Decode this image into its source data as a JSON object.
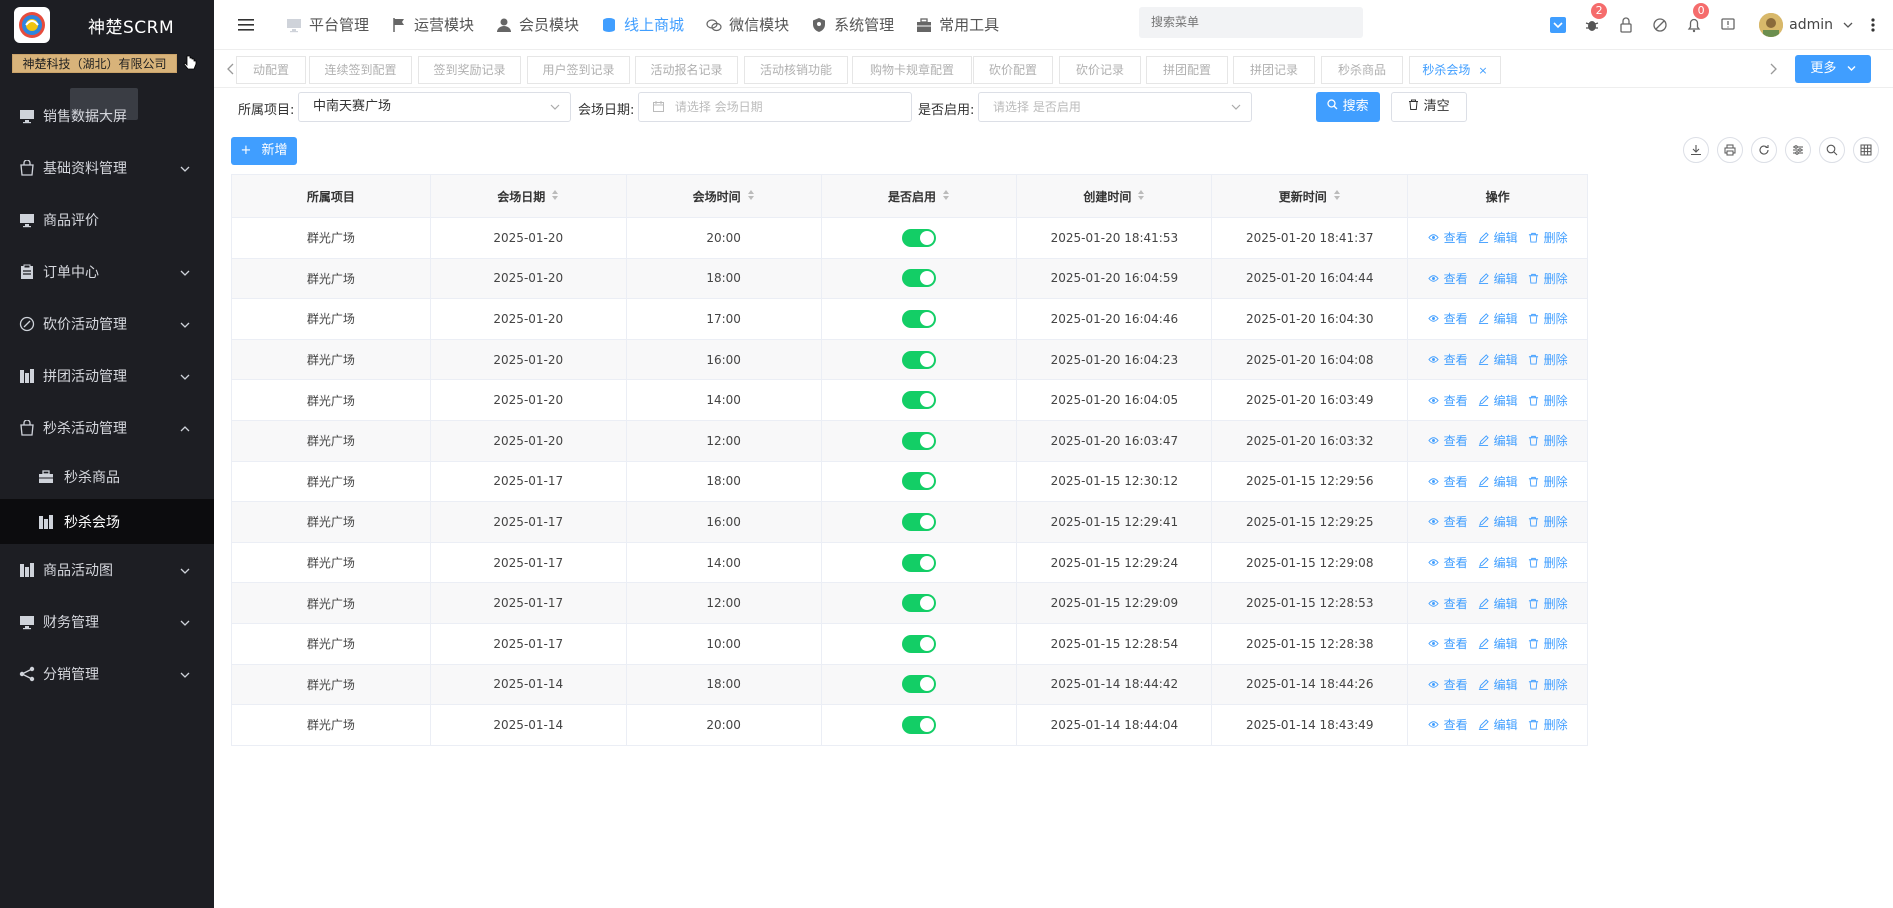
{
  "app": {
    "title": "神楚SCRM",
    "company": "神楚科技（湖北）有限公司"
  },
  "sidebar": {
    "items": [
      {
        "label": "销售数据大屏",
        "icon": "monitor-icon",
        "expandable": false
      },
      {
        "label": "基础资料管理",
        "icon": "bag-icon",
        "expandable": true
      },
      {
        "label": "商品评价",
        "icon": "monitor-icon",
        "expandable": false
      },
      {
        "label": "订单中心",
        "icon": "clipboard-icon",
        "expandable": true
      },
      {
        "label": "砍价活动管理",
        "icon": "discount-icon",
        "expandable": true
      },
      {
        "label": "拼团活动管理",
        "icon": "building-icon",
        "expandable": true
      },
      {
        "label": "秒杀活动管理",
        "icon": "bag-icon",
        "expandable": true,
        "expanded": true
      }
    ],
    "sub_items": [
      {
        "label": "秒杀商品",
        "icon": "briefcase-icon",
        "active": false
      },
      {
        "label": "秒杀会场",
        "icon": "building-icon",
        "active": true
      }
    ],
    "items_after": [
      {
        "label": "商品活动图",
        "icon": "building-icon",
        "expandable": true
      },
      {
        "label": "财务管理",
        "icon": "monitor-icon",
        "expandable": true
      },
      {
        "label": "分销管理",
        "icon": "share-icon",
        "expandable": true
      }
    ]
  },
  "topnav": {
    "items": [
      {
        "label": "平台管理",
        "icon": "monitor-icon",
        "active": false
      },
      {
        "label": "运营模块",
        "icon": "flag-icon",
        "active": false
      },
      {
        "label": "会员模块",
        "icon": "user-icon",
        "active": false
      },
      {
        "label": "线上商城",
        "icon": "cylinder-icon",
        "active": true
      },
      {
        "label": "微信模块",
        "icon": "wechat-icon",
        "active": false
      },
      {
        "label": "系统管理",
        "icon": "shield-icon",
        "active": false
      },
      {
        "label": "常用工具",
        "icon": "toolbox-icon",
        "active": false
      }
    ],
    "search_placeholder": "搜索菜单",
    "badge_1": "2",
    "badge_2": "0",
    "user": "admin"
  },
  "tabs": {
    "items": [
      {
        "label": "动配置",
        "active": false
      },
      {
        "label": "连续签到配置",
        "active": false
      },
      {
        "label": "签到奖励记录",
        "active": false
      },
      {
        "label": "用户签到记录",
        "active": false
      },
      {
        "label": "活动报名记录",
        "active": false
      },
      {
        "label": "活动核销功能",
        "active": false
      },
      {
        "label": "购物卡规章配置",
        "active": false
      },
      {
        "label": "砍价配置",
        "active": false
      },
      {
        "label": "砍价记录",
        "active": false
      },
      {
        "label": "拼团配置",
        "active": false
      },
      {
        "label": "拼团记录",
        "active": false
      },
      {
        "label": "秒杀商品",
        "active": false
      },
      {
        "label": "秒杀会场",
        "active": true
      }
    ],
    "close_glyph": "×",
    "more_label": "更多"
  },
  "filter": {
    "project_label": "所属项目:",
    "project_value": "中南天赛广场",
    "date_label": "会场日期:",
    "date_placeholder": "请选择 会场日期",
    "enabled_label": "是否启用:",
    "enabled_placeholder": "请选择 是否启用",
    "search_label": "搜索",
    "clear_label": "清空"
  },
  "actions": {
    "add_label": "新增"
  },
  "table": {
    "headers": [
      "所属项目",
      "会场日期",
      "会场时间",
      "是否启用",
      "创建时间",
      "更新时间",
      "操作"
    ],
    "sortable": [
      false,
      true,
      true,
      true,
      true,
      true,
      false
    ],
    "op_labels": {
      "view": "查看",
      "edit": "编辑",
      "delete": "删除"
    },
    "rows": [
      {
        "project": "群光广场",
        "date": "2025-01-20",
        "time": "20:00",
        "enabled": true,
        "created": "2025-01-20 18:41:53",
        "updated": "2025-01-20 18:41:37"
      },
      {
        "project": "群光广场",
        "date": "2025-01-20",
        "time": "18:00",
        "enabled": true,
        "created": "2025-01-20 16:04:59",
        "updated": "2025-01-20 16:04:44"
      },
      {
        "project": "群光广场",
        "date": "2025-01-20",
        "time": "17:00",
        "enabled": true,
        "created": "2025-01-20 16:04:46",
        "updated": "2025-01-20 16:04:30"
      },
      {
        "project": "群光广场",
        "date": "2025-01-20",
        "time": "16:00",
        "enabled": true,
        "created": "2025-01-20 16:04:23",
        "updated": "2025-01-20 16:04:08"
      },
      {
        "project": "群光广场",
        "date": "2025-01-20",
        "time": "14:00",
        "enabled": true,
        "created": "2025-01-20 16:04:05",
        "updated": "2025-01-20 16:03:49"
      },
      {
        "project": "群光广场",
        "date": "2025-01-20",
        "time": "12:00",
        "enabled": true,
        "created": "2025-01-20 16:03:47",
        "updated": "2025-01-20 16:03:32"
      },
      {
        "project": "群光广场",
        "date": "2025-01-17",
        "time": "18:00",
        "enabled": true,
        "created": "2025-01-15 12:30:12",
        "updated": "2025-01-15 12:29:56"
      },
      {
        "project": "群光广场",
        "date": "2025-01-17",
        "time": "16:00",
        "enabled": true,
        "created": "2025-01-15 12:29:41",
        "updated": "2025-01-15 12:29:25"
      },
      {
        "project": "群光广场",
        "date": "2025-01-17",
        "time": "14:00",
        "enabled": true,
        "created": "2025-01-15 12:29:24",
        "updated": "2025-01-15 12:29:08"
      },
      {
        "project": "群光广场",
        "date": "2025-01-17",
        "time": "12:00",
        "enabled": true,
        "created": "2025-01-15 12:29:09",
        "updated": "2025-01-15 12:28:53"
      },
      {
        "project": "群光广场",
        "date": "2025-01-17",
        "time": "10:00",
        "enabled": true,
        "created": "2025-01-15 12:28:54",
        "updated": "2025-01-15 12:28:38"
      },
      {
        "project": "群光广场",
        "date": "2025-01-14",
        "time": "18:00",
        "enabled": true,
        "created": "2025-01-14 18:44:42",
        "updated": "2025-01-14 18:44:26"
      },
      {
        "project": "群光广场",
        "date": "2025-01-14",
        "time": "20:00",
        "enabled": true,
        "created": "2025-01-14 18:44:04",
        "updated": "2025-01-14 18:43:49"
      }
    ]
  },
  "colors": {
    "primary": "#409eff",
    "switch_on": "#13ce66",
    "sidebar_bg": "#1d1e23",
    "badge": "#f56c6c"
  }
}
